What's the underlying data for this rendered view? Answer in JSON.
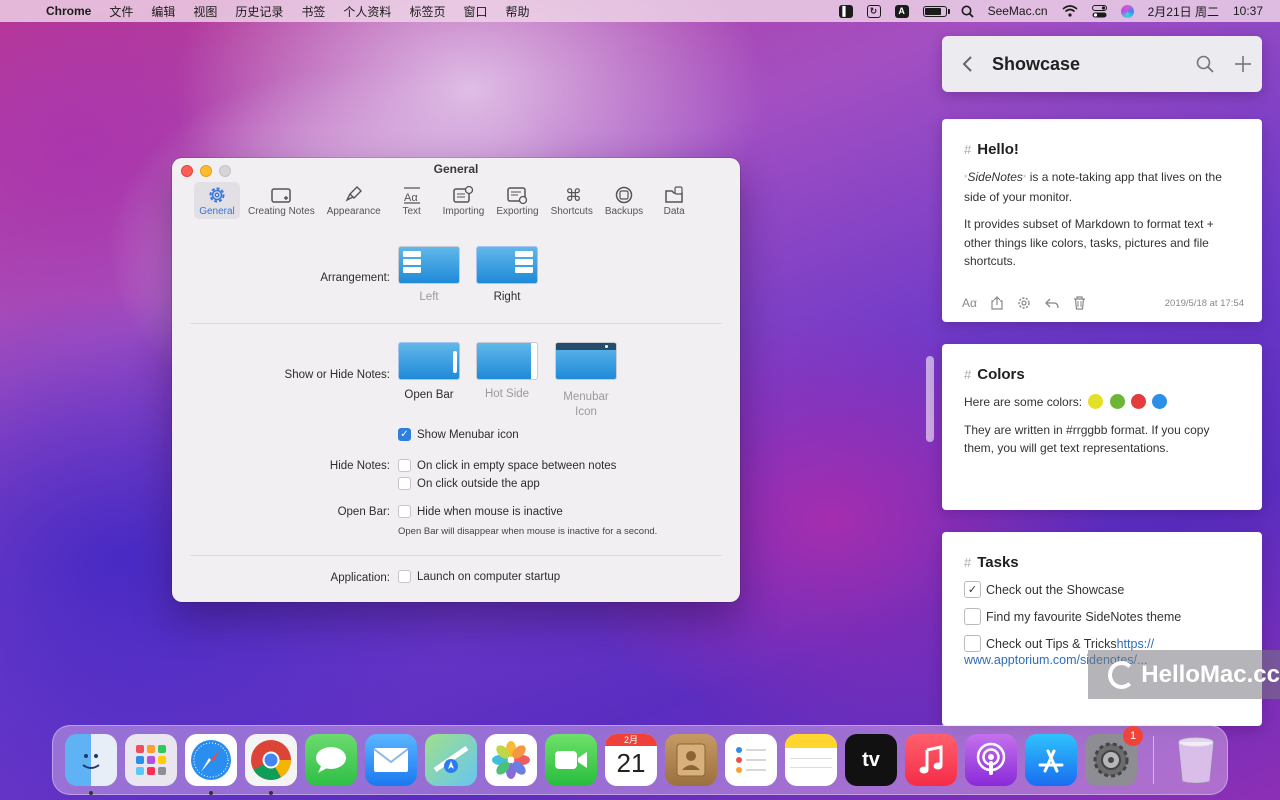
{
  "menubar": {
    "app_name": "Chrome",
    "items": [
      "文件",
      "编辑",
      "视图",
      "历史记录",
      "书签",
      "个人资料",
      "标签页",
      "窗口",
      "帮助"
    ],
    "site": "SeeMac.cn",
    "date": "2月21日 周二",
    "time": "10:37"
  },
  "prefs": {
    "title": "General",
    "tabs": [
      {
        "label": "General",
        "icon": "gear-icon",
        "active": true
      },
      {
        "label": "Creating Notes",
        "icon": "new-note-icon"
      },
      {
        "label": "Appearance",
        "icon": "paintbrush-icon"
      },
      {
        "label": "Text",
        "icon": "text-icon"
      },
      {
        "label": "Importing",
        "icon": "import-icon"
      },
      {
        "label": "Exporting",
        "icon": "export-icon"
      },
      {
        "label": "Shortcuts",
        "icon": "command-icon"
      },
      {
        "label": "Backups",
        "icon": "backup-icon"
      },
      {
        "label": "Data",
        "icon": "data-icon"
      }
    ],
    "arrangement_label": "Arrangement:",
    "arrangement_left": "Left",
    "arrangement_right": "Right",
    "show_hide_label": "Show or Hide Notes:",
    "open_bar": "Open Bar",
    "hot_side": "Hot Side",
    "menubar_icon_line1": "Menubar",
    "menubar_icon_line2": "Icon",
    "show_menubar_icon": "Show Menubar icon",
    "show_menubar_icon_checked": true,
    "hide_notes_label": "Hide Notes:",
    "hide_opt1": "On click in empty space between notes",
    "hide_opt2": "On click outside the app",
    "open_bar_label": "Open Bar:",
    "open_bar_opt": "Hide when mouse is inactive",
    "open_bar_hint": "Open Bar will disappear when mouse is inactive for a second.",
    "application_label": "Application:",
    "application_opt": "Launch on computer startup"
  },
  "sidenotes": {
    "header_title": "Showcase",
    "notes": [
      {
        "title": "Hello!",
        "p1_em": "SideNotes",
        "p1_rest": " is a note-taking app that lives on the side of your monitor.",
        "p2": "It provides subset of Markdown to format text + other things like colors, tasks, pictures and file shortcuts.",
        "date": "2019/5/18 at 17:54"
      },
      {
        "title": "Colors",
        "p1": "Here are some colors:",
        "colors": [
          "#e4e02a",
          "#6db536",
          "#e43c3c",
          "#2b8fe6"
        ],
        "p2": "They are written in #rrggbb format. If you copy them, you will get text representations."
      },
      {
        "title": "Tasks",
        "tasks": [
          {
            "label": "Check out the Showcase",
            "done": true
          },
          {
            "label": "Find my favourite SideNotes theme",
            "done": false
          }
        ],
        "task3_text": "Check out Tips & Tricks ",
        "task3_link_a": "https://",
        "task3_link_b": "www.apptorium.com/sidenotes/..."
      }
    ]
  },
  "watermark": "HelloMac.cc",
  "dock": {
    "calendar_month": "2月",
    "calendar_day": "21",
    "tv_label": "tv",
    "settings_badge": "1"
  }
}
